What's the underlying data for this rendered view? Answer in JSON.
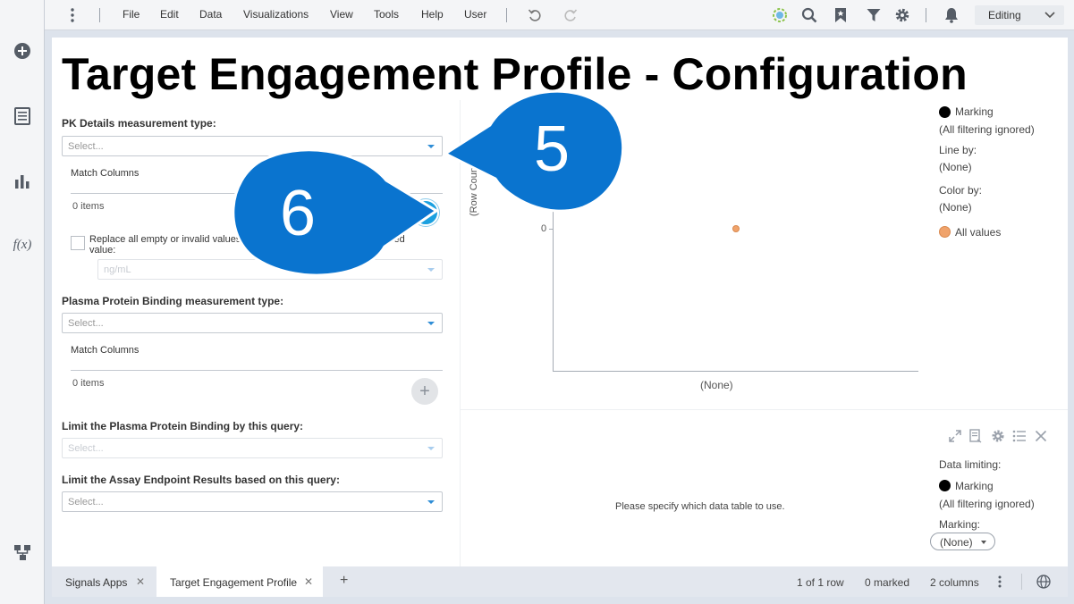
{
  "menu": {
    "items": [
      "File",
      "Edit",
      "Data",
      "Visualizations",
      "View",
      "Tools",
      "Help",
      "User"
    ],
    "mode": "Editing"
  },
  "leftrail": {
    "icons": [
      "add-icon",
      "data-table-icon",
      "bar-chart-icon",
      "function-icon",
      "data-canvas-icon"
    ],
    "fx_label": "f(x)"
  },
  "page": {
    "title": "Target Engagement Profile - Configuration"
  },
  "form": {
    "pk": {
      "label": "PK Details measurement type:",
      "placeholder": "Select...",
      "match_columns": "Match Columns",
      "items": "0 items",
      "add": "+"
    },
    "replace": {
      "label": "Replace all empty or invalid values in this column with this user-provided value:",
      "unit": "ng/mL"
    },
    "ppb": {
      "label": "Plasma Protein Binding measurement type:",
      "placeholder": "Select...",
      "match_columns": "Match Columns",
      "items": "0 items",
      "add": "+"
    },
    "limit_ppb": {
      "label": "Limit the Plasma Protein Binding by this query:",
      "placeholder": "Select..."
    },
    "limit_assay": {
      "label": "Limit the Assay Endpoint Results based on this query:",
      "placeholder": "Select..."
    }
  },
  "chart_data": {
    "type": "scatter",
    "x": [
      "(None)"
    ],
    "y": [
      0
    ],
    "xlabel": "(None)",
    "ylabel": "(Row Count)",
    "y_ticks": [
      "0"
    ],
    "point_color": "#f0a36b"
  },
  "legend": {
    "marking": "Marking",
    "marking_note": "(All filtering ignored)",
    "line_by_label": "Line by:",
    "line_by_value": "(None)",
    "color_by_label": "Color by:",
    "color_by_value": "(None)",
    "all_values": "All values"
  },
  "lower_panel": {
    "message": "Please specify which data table to use.",
    "data_limiting": "Data limiting:",
    "marking": "Marking",
    "marking_note": "(All filtering ignored)",
    "marking_label": "Marking:",
    "marking_value": "(None)"
  },
  "bottom": {
    "tabs": [
      "Signals Apps",
      "Target Engagement Profile"
    ],
    "add_tab": "+",
    "close": "✕",
    "rows": "1 of 1 row",
    "marked": "0 marked",
    "columns": "2 columns"
  },
  "callouts": {
    "five": "5",
    "six": "6",
    "color": "#0a74cf"
  }
}
